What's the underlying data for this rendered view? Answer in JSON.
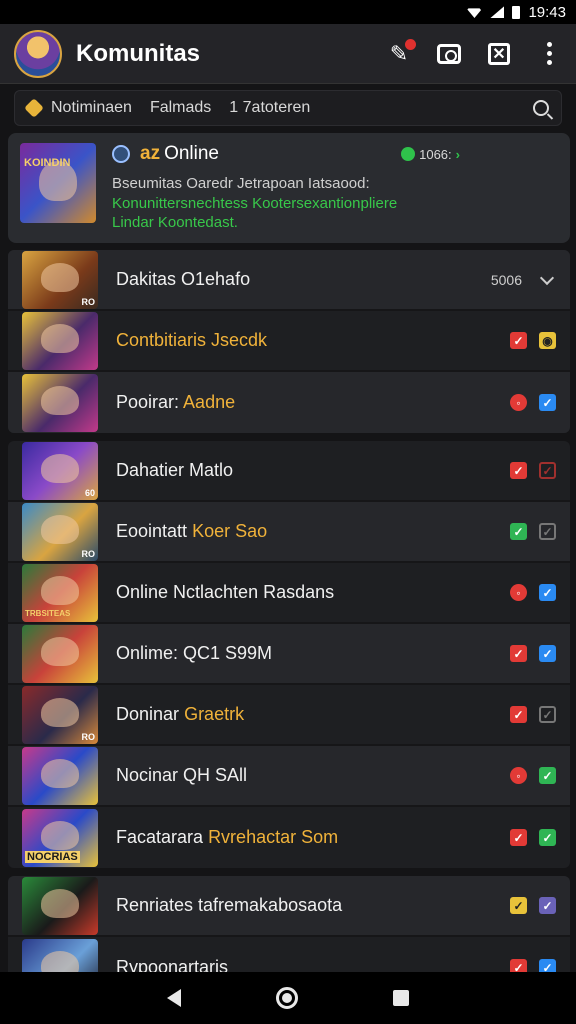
{
  "status_bar": {
    "time": "19:43"
  },
  "app": {
    "title": "Komunitas"
  },
  "search": {
    "tag1": "Notiminaen",
    "tag2": "Falmads",
    "tag3": "1 7atoteren"
  },
  "online_card": {
    "title_prefix": "az",
    "title": "Online",
    "count": "1066:",
    "line1": "Bseumitas Oaredr Jetrapoan Iatsaood:",
    "line2": "Konunittersnechtess Kootersexantionpliere Lindar Koontedast."
  },
  "header_row": {
    "label": "Dakitas O1ehafo",
    "count": "5006"
  },
  "rows": [
    {
      "label": "Contbitiaris Jsecdk",
      "highlight": ""
    },
    {
      "label": "Pooirar:",
      "highlight": "Aadne"
    },
    {
      "label": "Dahatier Matlo",
      "highlight": ""
    },
    {
      "label": "Eoointatt",
      "highlight": "Koer Sao"
    },
    {
      "label": "Online Nctlachten Rasdans",
      "highlight": ""
    },
    {
      "label": "Onlime: QC1 S99M",
      "highlight": ""
    },
    {
      "label": "Doninar",
      "highlight": "Graetrk"
    },
    {
      "label": "Nocinar QH SAll",
      "highlight": ""
    },
    {
      "label": "Facatarara",
      "highlight": "Rvrehactar Som"
    },
    {
      "label": "Renriates tafremakabosaota",
      "highlight": ""
    },
    {
      "label": "Rypoonartaris",
      "highlight": ""
    }
  ],
  "thumb_labels": {
    "big": "KOINDIN",
    "t0": "RO",
    "t2": "60",
    "t3": "RO",
    "t4": "TRBSITEAS",
    "t5": "RO",
    "t6": "NOCRIAS"
  },
  "colors": {
    "accent": "#f0b23a",
    "online": "#2fc24b",
    "background": "#141416"
  }
}
